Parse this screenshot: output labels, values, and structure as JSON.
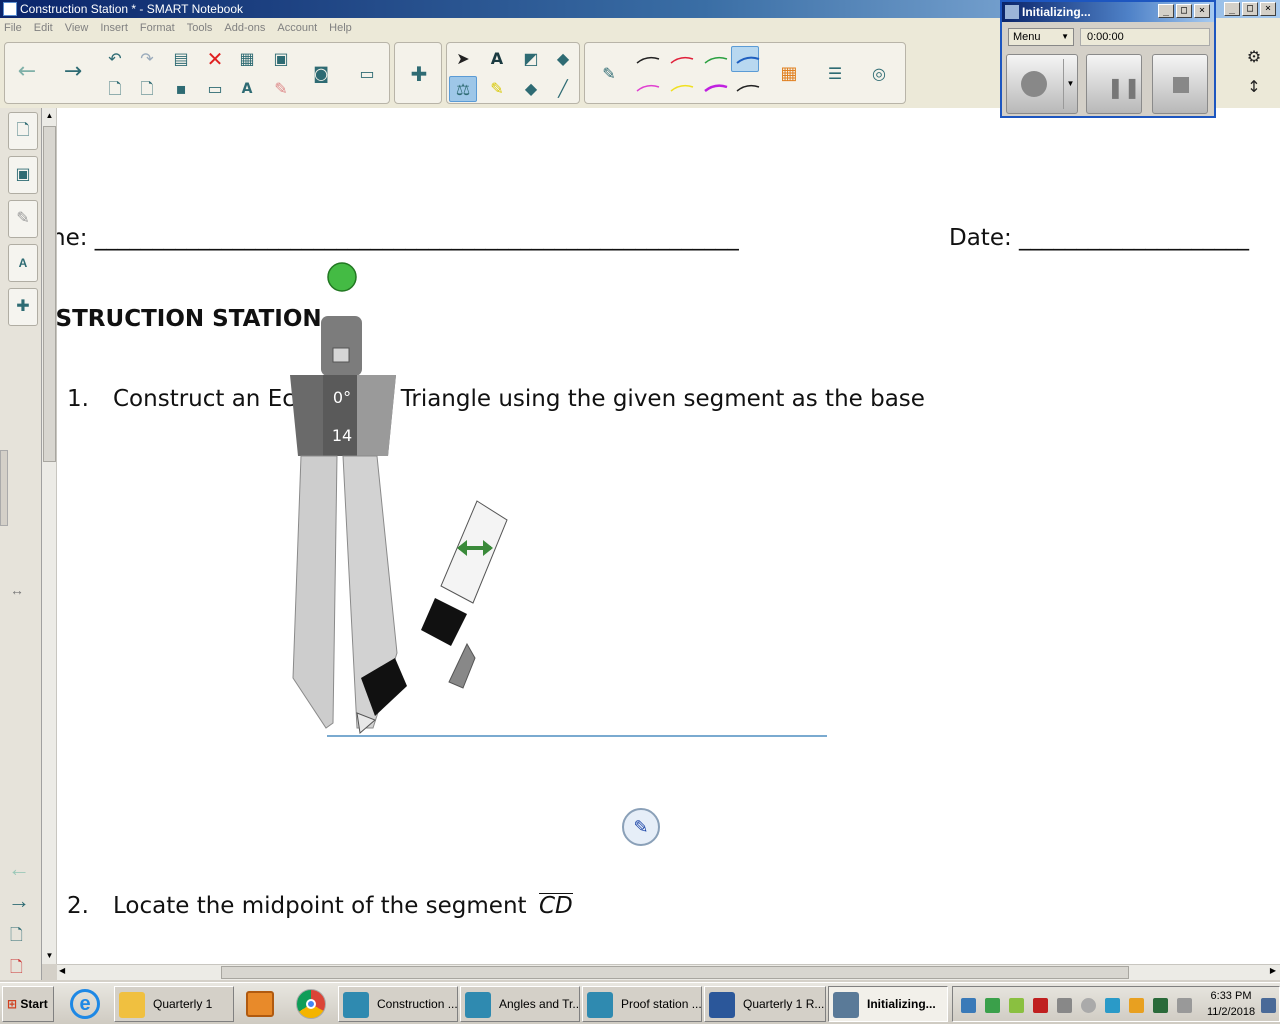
{
  "app": {
    "window_title": "Construction Station * - SMART Notebook",
    "window_controls": {
      "minimize": "_",
      "maximize": "□",
      "close": "×"
    }
  },
  "menu": [
    "File",
    "Edit",
    "View",
    "Insert",
    "Format",
    "Tools",
    "Add-ons",
    "Account",
    "Help"
  ],
  "toolbar": {
    "icons": [
      "back-arrow-icon",
      "forward-arrow-icon",
      "undo-icon",
      "redo-icon",
      "paste-icon",
      "delete-icon",
      "table-icon",
      "screen-shade-icon",
      "camera-icon",
      "add-page-icon",
      "delete-page-icon",
      "save-icon",
      "full-screen-icon",
      "text-spell-icon",
      "clear-ink-icon",
      "document-camera-icon",
      "addons-icon",
      "select-icon",
      "text-icon",
      "shapes-icon",
      "fill-icon",
      "measurement-tools-icon",
      "highlighter-icon",
      "eraser-icon",
      "line-icon",
      "pen-icon",
      "color-palette-icon",
      "line-style-icon",
      "magic-pen-icon"
    ],
    "pen_colors": [
      "#222222",
      "#e0203a",
      "#2aa040",
      "#1f5fc0",
      "#e040d0",
      "#f0e020",
      "#c020e0",
      "#222222"
    ],
    "accent": "#2e6b73",
    "selected_tool": "measurement-tools-icon"
  },
  "document": {
    "name_label": "ne: ________________________________________________________",
    "date_label": "Date: ____________________",
    "heading": "ISTRUCTION STATION",
    "q1_number": "1.",
    "q1_text_left": "Construct an Ec",
    "q1_text_right": "l Triangle using the given segment as the base",
    "q2_number": "2.",
    "q2_text": "Locate the midpoint of the segment",
    "q2_segment": "CD"
  },
  "compass": {
    "angle_label": "0°",
    "radius_label": "14",
    "resize_icon": "double-arrow-icon"
  },
  "recorder": {
    "title": "Initializing...",
    "menu_label": "Menu",
    "time": "0:00:00",
    "buttons": [
      "record-icon",
      "pause-icon",
      "stop-icon"
    ]
  },
  "taskbar": {
    "start": "Start",
    "items": [
      {
        "label": "Quarterly 1",
        "icon": "folder-icon"
      },
      {
        "label": "Construction ...",
        "icon": "smart-notebook-icon"
      },
      {
        "label": "Angles and Tr...",
        "icon": "smart-notebook-icon"
      },
      {
        "label": "Proof station ...",
        "icon": "smart-notebook-icon"
      },
      {
        "label": "Quarterly 1 R...",
        "icon": "word-icon"
      },
      {
        "label": "Initializing...",
        "icon": "recorder-icon"
      }
    ],
    "clock_time": "6:33 PM",
    "clock_date": "11/2/2018"
  }
}
